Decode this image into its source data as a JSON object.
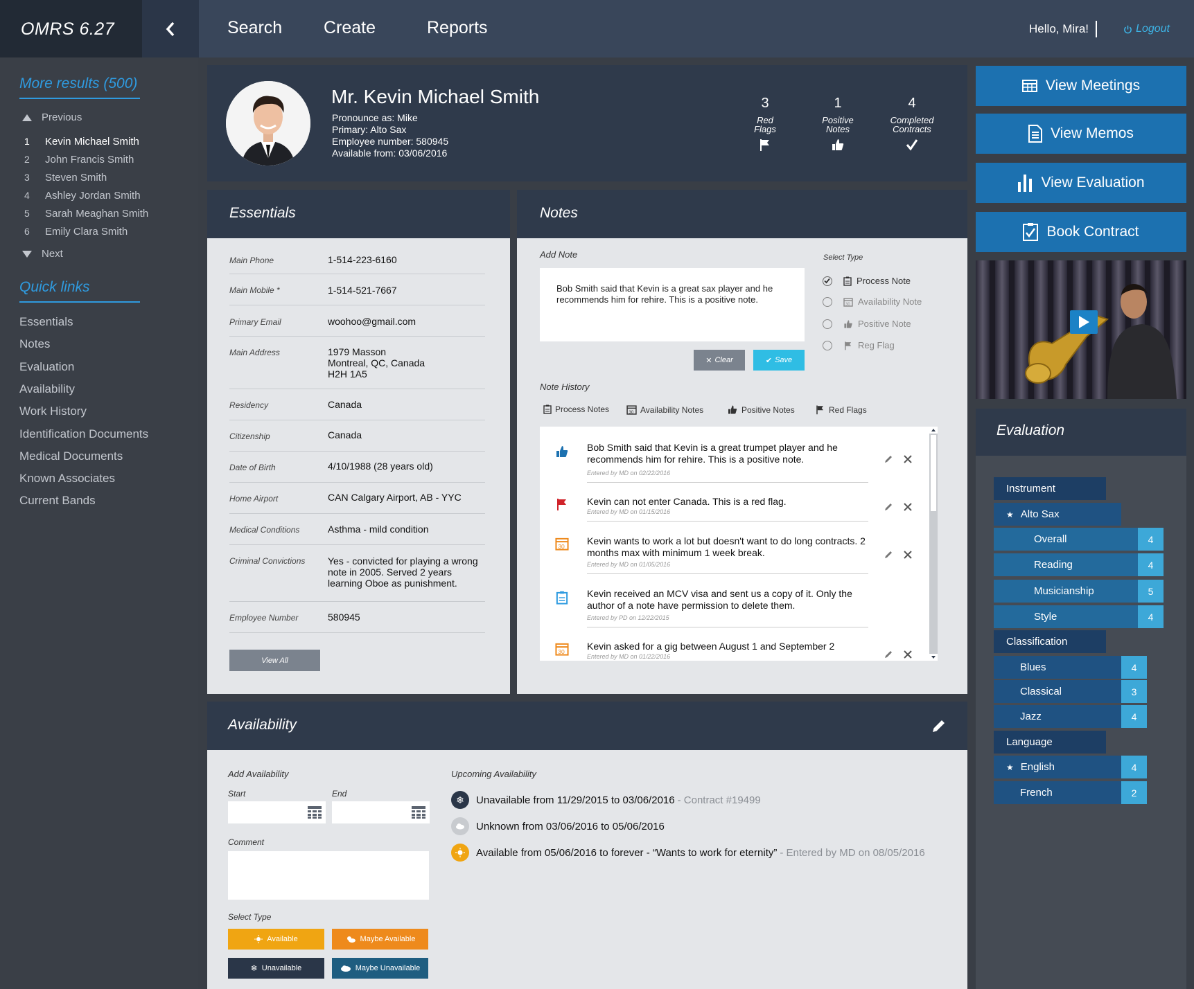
{
  "app": {
    "title": "OMRS 6.27"
  },
  "nav": {
    "search": "Search",
    "create": "Create",
    "reports": "Reports"
  },
  "user": {
    "greeting": "Hello, Mira!",
    "logout": "Logout"
  },
  "sidebar": {
    "more_results": "More results (500)",
    "previous": "Previous",
    "next": "Next",
    "results": [
      {
        "num": "1",
        "name": "Kevin Michael Smith"
      },
      {
        "num": "2",
        "name": "John Francis Smith"
      },
      {
        "num": "3",
        "name": "Steven Smith"
      },
      {
        "num": "4",
        "name": "Ashley Jordan Smith"
      },
      {
        "num": "5",
        "name": "Sarah Meaghan Smith"
      },
      {
        "num": "6",
        "name": "Emily Clara Smith"
      }
    ],
    "quick_links_title": "Quick links",
    "quick_links": [
      "Essentials",
      "Notes",
      "Evaluation",
      "Availability",
      "Work History",
      "Identification Documents",
      "Medical Documents",
      "Known Associates",
      "Current Bands"
    ]
  },
  "profile": {
    "name": "Mr. Kevin Michael Smith",
    "pronounce": "Pronounce as:  Mike",
    "primary": "Primary:  Alto Sax",
    "employee": "Employee number:  580945",
    "available": "Available from:  03/06/2016",
    "stats": [
      {
        "value": "3",
        "label1": "Red",
        "label2": "Flags",
        "icon": "flag-icon"
      },
      {
        "value": "1",
        "label1": "Positive",
        "label2": "Notes",
        "icon": "thumbs-up-icon"
      },
      {
        "value": "4",
        "label1": "Completed",
        "label2": "Contracts",
        "icon": "check-icon"
      }
    ]
  },
  "actions": {
    "meetings": "View Meetings",
    "memos": "View Memos",
    "evaluation": "View Evaluation",
    "contract": "Book Contract"
  },
  "essentials": {
    "title": "Essentials",
    "rows": [
      {
        "label": "Main Phone",
        "value": "1-514-223-6160"
      },
      {
        "label": "Main Mobile *",
        "value": "1-514-521-7667"
      },
      {
        "label": "Primary Email",
        "value": "woohoo@gmail.com"
      },
      {
        "label": "Main Address",
        "value": "1979 Masson\nMontreal, QC, Canada\nH2H 1A5"
      },
      {
        "label": "Residency",
        "value": "Canada"
      },
      {
        "label": "Citizenship",
        "value": "Canada"
      },
      {
        "label": "Date of Birth",
        "value": "4/10/1988 (28 years old)"
      },
      {
        "label": "Home Airport",
        "value": "CAN Calgary Airport, AB - YYC"
      },
      {
        "label": "Medical Conditions",
        "value": "Asthma - mild condition"
      },
      {
        "label": "Criminal Convictions",
        "value": "Yes - convicted for playing a wrong\nnote in 2005. Served 2 years\nlearning Oboe as punishment."
      },
      {
        "label": "Employee Number",
        "value": "580945"
      }
    ],
    "view_all": "View All"
  },
  "notes": {
    "title": "Notes",
    "add_note": "Add Note",
    "note_value": "Bob Smith said that Kevin is a great sax player and he recommends him for rehire. This is a positive note.",
    "select_type": "Select Type",
    "types": [
      "Process Note",
      "Availability Note",
      "Positive Note",
      "Reg Flag"
    ],
    "clear": "Clear",
    "save": "Save",
    "history_title": "Note History",
    "history_tabs": [
      "Process Notes",
      "Availability Notes",
      "Positive Notes",
      "Red Flags"
    ],
    "items": [
      {
        "text": "Bob Smith said that Kevin is a great trumpet player and he recommends him for rehire. This is a positive note.",
        "by": "Entered by MD on 02/22/2016",
        "icon": "thumbs-up-icon"
      },
      {
        "text": "Kevin can not enter Canada. This is a red flag.",
        "by": "Entered by MD on 01/15/2016",
        "icon": "red-flag-icon"
      },
      {
        "text": "Kevin wants to work a lot but doesn't want to do long contracts. 2 months max with minimum 1 week break.",
        "by": "Entered by MD on 01/05/2016",
        "icon": "calendar-icon"
      },
      {
        "text": "Kevin received an MCV visa and sent us a copy of it. Only the author of a note have permission to delete them.",
        "by": "Entered by PD on 12/22/2015",
        "icon": "clipboard-icon"
      },
      {
        "text": "Kevin asked for a gig between August 1 and September 2",
        "by": "Entered by MD on 01/22/2016",
        "icon": "calendar-icon"
      }
    ]
  },
  "evaluation": {
    "title": "Evaluation",
    "instrument": "Instrument",
    "instrument_name": "Alto Sax",
    "instrument_scores": [
      {
        "label": "Overall",
        "score": "4"
      },
      {
        "label": "Reading",
        "score": "4"
      },
      {
        "label": "Musicianship",
        "score": "5"
      },
      {
        "label": "Style",
        "score": "4"
      }
    ],
    "classification": "Classification",
    "classes": [
      {
        "label": "Blues",
        "score": "4"
      },
      {
        "label": "Classical",
        "score": "3"
      },
      {
        "label": "Jazz",
        "score": "4"
      }
    ],
    "language": "Language",
    "languages": [
      {
        "label": "English",
        "score": "4",
        "star": true
      },
      {
        "label": "French",
        "score": "2",
        "star": false
      }
    ]
  },
  "availability": {
    "title": "Availability",
    "add": "Add Availability",
    "start": "Start",
    "end": "End",
    "comment": "Comment",
    "select_type": "Select Type",
    "buttons": [
      "Available",
      "Maybe Available",
      "Unavailable",
      "Maybe Unavailable"
    ],
    "colors": {
      "available": "#f0a512",
      "maybe_available": "#ee8a1c",
      "unavailable": "#2a3648",
      "maybe_unavailable": "#1e5d80"
    },
    "upcoming_title": "Upcoming Availability",
    "upcoming": [
      {
        "text": "Unavailable from 11/29/2015 to 03/06/2016",
        "meta": "- Contract #19499"
      },
      {
        "text": "Unknown from 03/06/2016 to 05/06/2016",
        "meta": ""
      },
      {
        "text": "Available from 05/06/2016 to forever - “Wants to work for eternity”",
        "meta": "- Entered by MD on 08/05/2016"
      }
    ]
  }
}
